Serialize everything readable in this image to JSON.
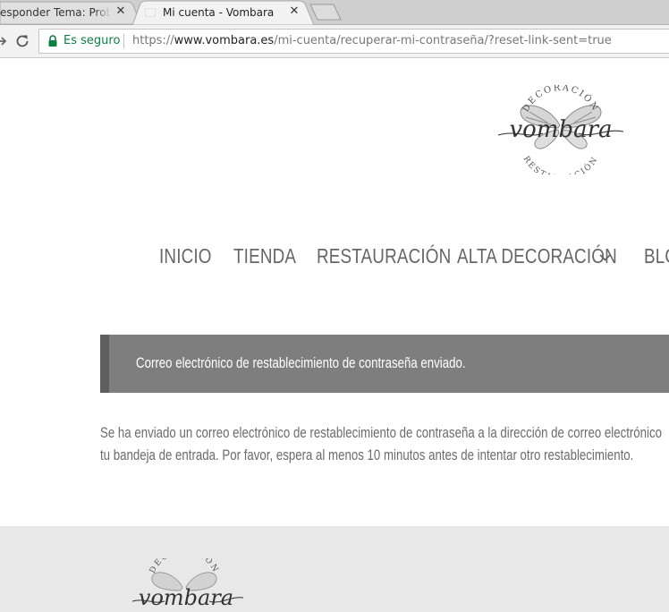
{
  "browser": {
    "tabs": [
      {
        "title": "esponder Tema: Problem",
        "close": "✕"
      },
      {
        "title": "Mi cuenta - Vombara",
        "close": "✕"
      }
    ],
    "security_label": "Es seguro",
    "url": {
      "scheme": "https://",
      "host": "www.vombara.es",
      "path": "/mi-cuenta/recuperar-mi-contraseña/?reset-link-sent=true"
    }
  },
  "site": {
    "logo": {
      "top": "DECORACIÓN",
      "name": "vombara",
      "bottom": "RESTAURACIÓN"
    },
    "nav": [
      {
        "label": "INICIO"
      },
      {
        "label": "TIENDA"
      },
      {
        "label": "RESTAURACIÓN"
      },
      {
        "label": "ALTA DECORACIÓN"
      },
      {
        "label": "BLO"
      }
    ]
  },
  "main": {
    "notice": "Correo electrónico de restablecimiento de contraseña enviado.",
    "message_line1": "Se ha enviado un correo electrónico de restablecimiento de contraseña a la dirección de correo electrónico",
    "message_line2": "tu bandeja de entrada. Por favor, espera al menos 10 minutos antes de intentar otro restablecimiento."
  },
  "footer": {
    "logo": {
      "top": "DECORACIÓN",
      "name": "vombara"
    }
  },
  "colors": {
    "secure_green": "#0b8043",
    "notice_bg": "#7e7e7e",
    "notice_border": "#5f5f5f",
    "nav_text": "#666666",
    "footer_bg": "#e8e8e8"
  }
}
